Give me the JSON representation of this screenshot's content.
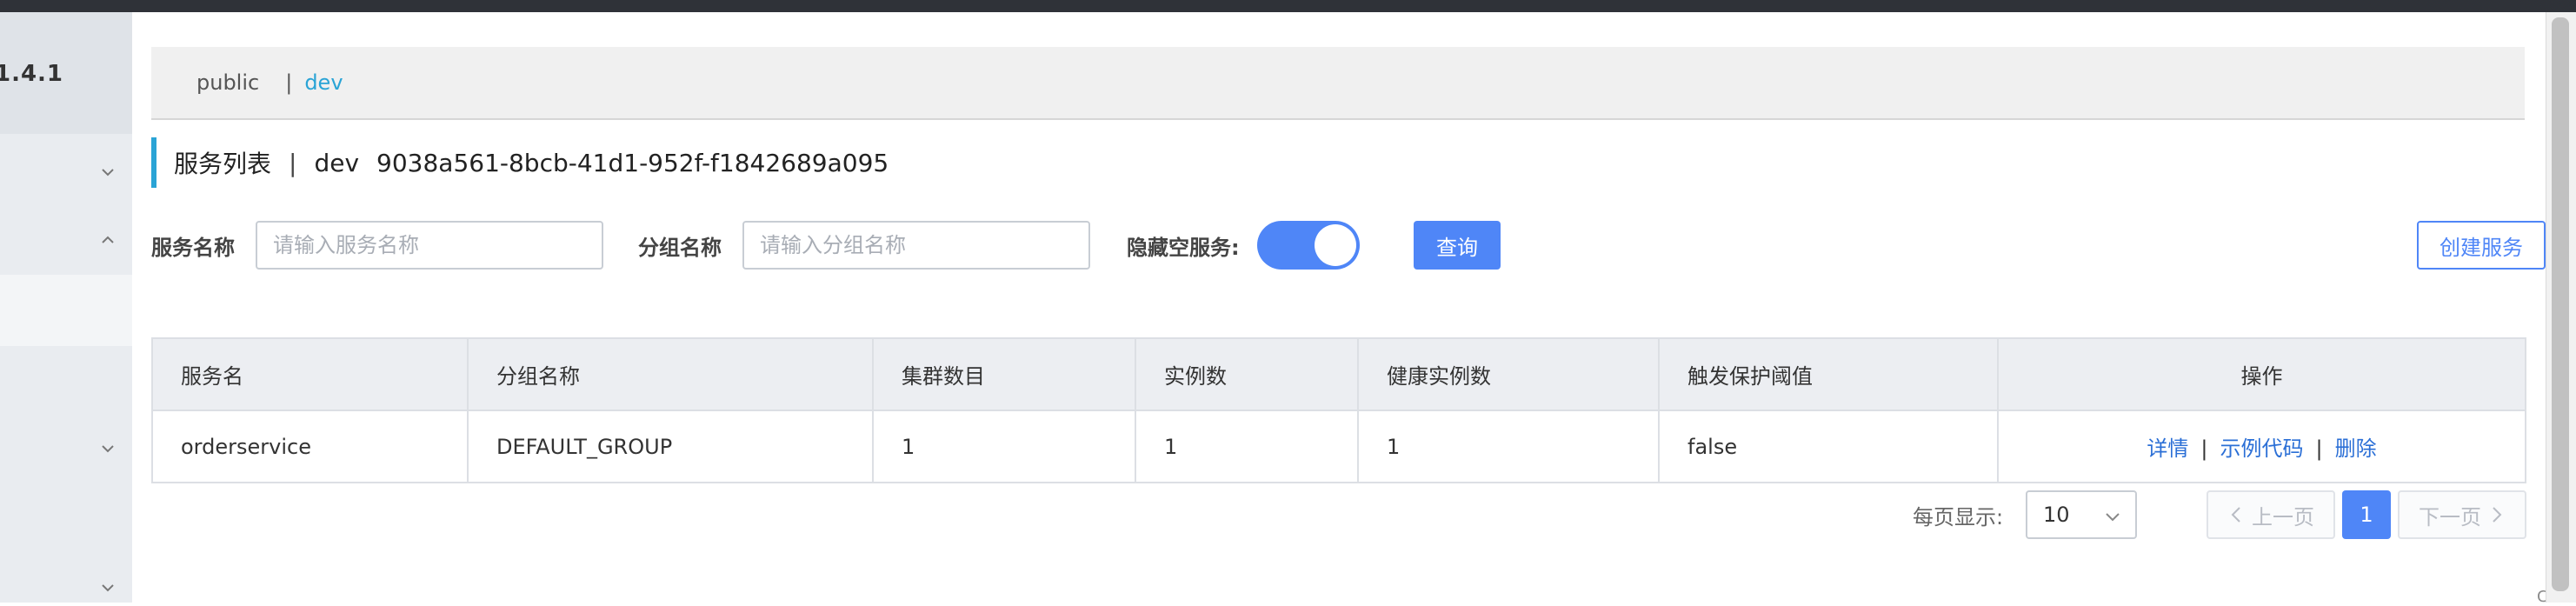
{
  "sidebar": {
    "version": "1.4.1"
  },
  "namespaces": {
    "items": [
      "public",
      "dev"
    ],
    "separator": "|",
    "active_index": 1
  },
  "header": {
    "title": "服务列表",
    "divider": "|",
    "namespace": "dev",
    "namespace_id": "9038a561-8bcb-41d1-952f-f1842689a095"
  },
  "filters": {
    "service_name_label": "服务名称",
    "service_name_placeholder": "请输入服务名称",
    "service_name_value": "",
    "group_name_label": "分组名称",
    "group_name_placeholder": "请输入分组名称",
    "group_name_value": "",
    "hide_empty_label": "隐藏空服务:",
    "hide_empty_on": true,
    "query_button": "查询",
    "create_button": "创建服务"
  },
  "table": {
    "columns": [
      "服务名",
      "分组名称",
      "集群数目",
      "实例数",
      "健康实例数",
      "触发保护阈值",
      "操作"
    ],
    "rows": [
      {
        "service_name": "orderservice",
        "group_name": "DEFAULT_GROUP",
        "cluster_count": "1",
        "instance_count": "1",
        "healthy_instance_count": "1",
        "protect_threshold": "false",
        "actions": {
          "detail": "详情",
          "sample_code": "示例代码",
          "delete": "删除",
          "separator": "|"
        }
      }
    ]
  },
  "pagination": {
    "page_size_label": "每页显示:",
    "page_size": "10",
    "prev_label": "上一页",
    "next_label": "下一页",
    "current_page": "1"
  },
  "watermark": "CSDN @Ding Jiaxiong",
  "colors": {
    "primary": "#4f86f7",
    "accent": "#2aa4d6",
    "link": "#2b6fd6"
  }
}
